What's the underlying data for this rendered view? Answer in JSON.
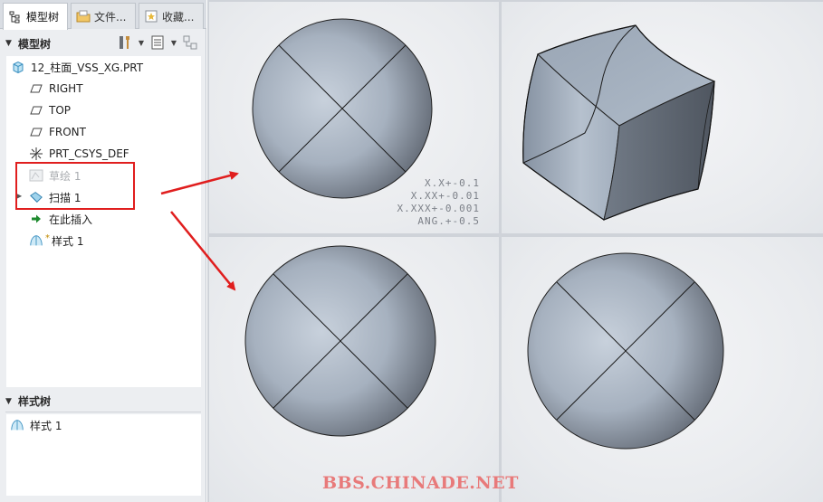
{
  "tabs": [
    {
      "label": "模型树",
      "icon": "model-tree-icon",
      "active": true
    },
    {
      "label": "文件...",
      "icon": "folder-browser-icon",
      "active": false
    },
    {
      "label": "收藏...",
      "icon": "favorites-icon",
      "active": false
    }
  ],
  "model_tree": {
    "header": "模型树",
    "root": "12_柱面_VSS_XG.PRT",
    "items": [
      {
        "label": "RIGHT",
        "icon": "datum-plane-icon"
      },
      {
        "label": "TOP",
        "icon": "datum-plane-icon"
      },
      {
        "label": "FRONT",
        "icon": "datum-plane-icon"
      },
      {
        "label": "PRT_CSYS_DEF",
        "icon": "coordinate-system-icon"
      },
      {
        "label": "草绘 1",
        "icon": "sketch-icon",
        "suppressed": true
      },
      {
        "label": "扫描 1",
        "icon": "sweep-icon"
      },
      {
        "label": "在此插入",
        "icon": "insert-here-arrow-icon"
      },
      {
        "label": "样式 1",
        "icon": "style-surface-icon",
        "prefix": "*"
      }
    ]
  },
  "style_tree": {
    "header": "样式树",
    "items": [
      {
        "label": "样式 1",
        "icon": "style-surface-icon"
      }
    ]
  },
  "tolerances": [
    "X.X+-0.1",
    "X.XX+-0.01",
    "X.XXX+-0.001",
    "ANG.+-0.5"
  ],
  "watermark": "BBS.CHINADE.NET",
  "colors": {
    "annotation_red": "#e01e1e",
    "model_surface": "#a7b3c2",
    "watermark": "#e87a7a"
  }
}
